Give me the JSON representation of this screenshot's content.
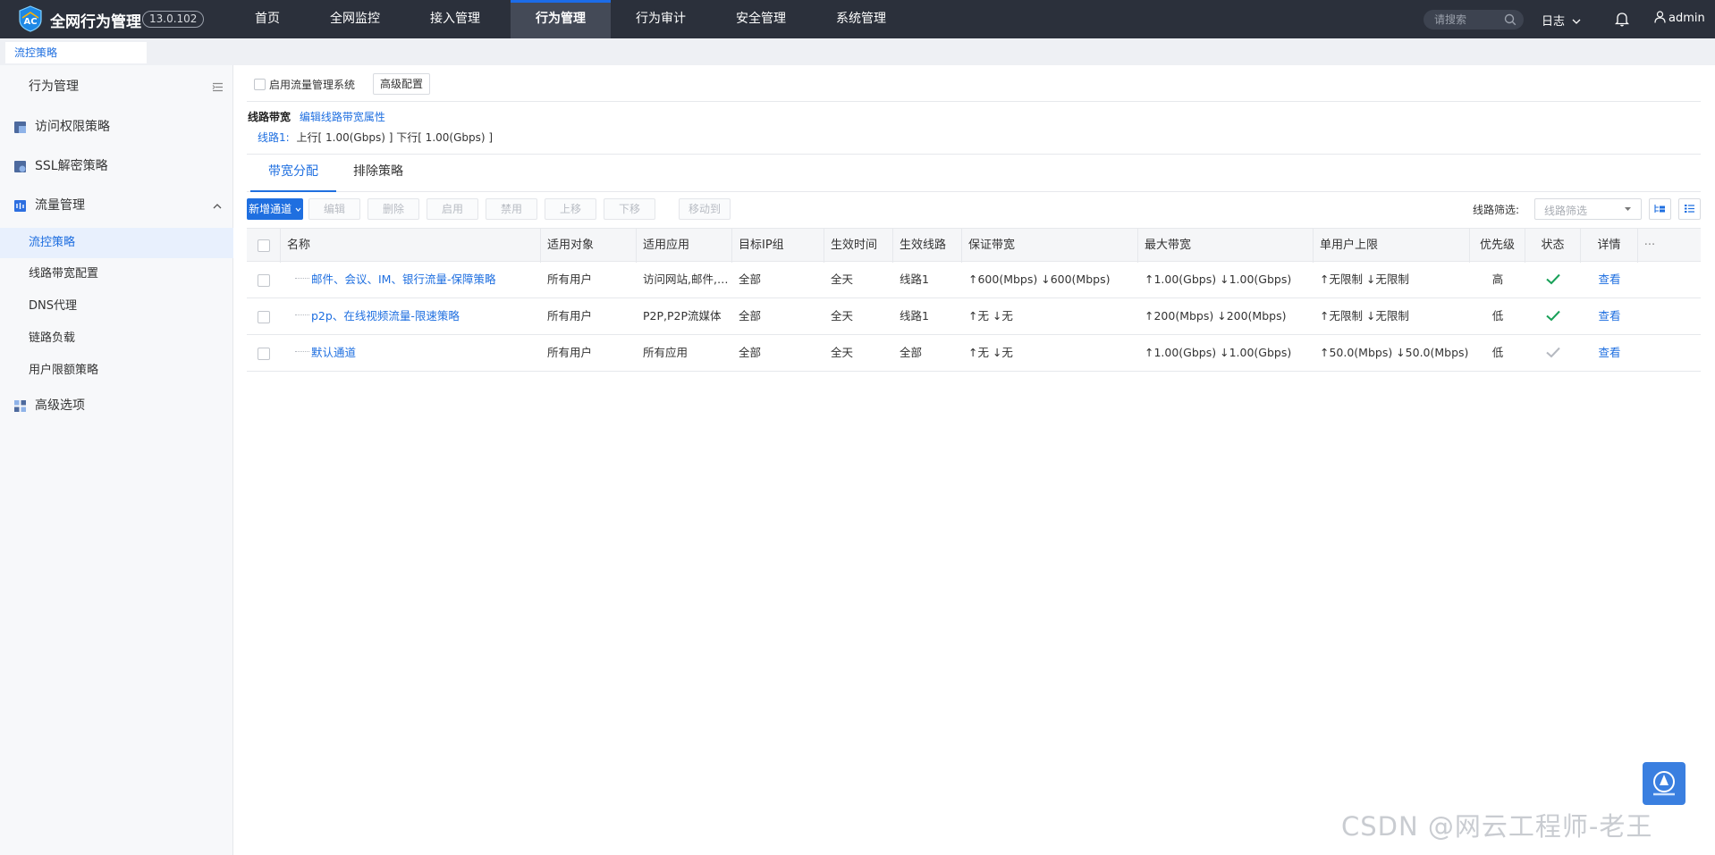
{
  "header": {
    "app_title": "全网行为管理",
    "version": "13.0.102",
    "nav": [
      "首页",
      "全网监控",
      "接入管理",
      "行为管理",
      "行为审计",
      "安全管理",
      "系统管理"
    ],
    "nav_active": "行为管理",
    "search_placeholder": "请搜索",
    "log_label": "日志",
    "user_label": "admin"
  },
  "breadcrumb": {
    "tab_label": "流控策略"
  },
  "sidebar": {
    "title": "行为管理",
    "items": [
      {
        "label": "访问权限策略",
        "icon": "access-policy-icon"
      },
      {
        "label": "SSL解密策略",
        "icon": "ssl-decrypt-icon"
      },
      {
        "label": "流量管理",
        "icon": "traffic-management-icon"
      },
      {
        "label": "高级选项",
        "icon": "advanced-options-icon"
      }
    ],
    "subitems": [
      "流控策略",
      "线路带宽配置",
      "DNS代理",
      "链路负载",
      "用户限额策略"
    ],
    "active_sub": "流控策略"
  },
  "main": {
    "enable_label": "启用流量管理系统",
    "advanced_button": "高级配置",
    "line_bw_title": "线路带宽",
    "edit_line_link": "编辑线路带宽属性",
    "line_name": "线路1:",
    "line_value": "上行[ 1.00(Gbps) ] 下行[ 1.00(Gbps) ]",
    "tabs": [
      "带宽分配",
      "排除策略"
    ],
    "toolbar": {
      "new_channel": "新增通道",
      "edit": "编辑",
      "delete": "删除",
      "enable": "启用",
      "disable": "禁用",
      "move_up": "上移",
      "move_down": "下移",
      "move_to": "移动到",
      "line_filter_label": "线路筛选:",
      "line_filter_placeholder": "线路筛选"
    },
    "table": {
      "headers": [
        "名称",
        "适用对象",
        "适用应用",
        "目标IP组",
        "生效时间",
        "生效线路",
        "保证带宽",
        "最大带宽",
        "单用户上限",
        "优先级",
        "状态",
        "详情",
        "···"
      ],
      "rows": [
        {
          "name": "邮件、会议、IM、银行流量-保障策略",
          "object": "所有用户",
          "app": "访问网站,邮件,微博...",
          "ip": "全部",
          "time": "全天",
          "line": "线路1",
          "guarantee": "↑600(Mbps) ↓600(Mbps)",
          "max": "↑1.00(Gbps) ↓1.00(Gbps)",
          "per_user": "↑无限制 ↓无限制",
          "priority": "高",
          "status": "enabled",
          "detail": "查看"
        },
        {
          "name": "p2p、在线视频流量-限速策略",
          "object": "所有用户",
          "app": "P2P,P2P流媒体",
          "ip": "全部",
          "time": "全天",
          "line": "线路1",
          "guarantee": "↑无 ↓无",
          "max": "↑200(Mbps) ↓200(Mbps)",
          "per_user": "↑无限制 ↓无限制",
          "priority": "低",
          "status": "enabled",
          "detail": "查看"
        },
        {
          "name": "默认通道",
          "object": "所有用户",
          "app": "所有应用",
          "ip": "全部",
          "time": "全天",
          "line": "全部",
          "guarantee": "↑无 ↓无",
          "max": "↑1.00(Gbps) ↓1.00(Gbps)",
          "per_user": "↑50.0(Mbps) ↓50.0(Mbps)",
          "priority": "低",
          "status": "default",
          "detail": "查看"
        }
      ]
    }
  },
  "watermark": "CSDN @网云工程师-老王",
  "colors": {
    "accent": "#1f6fe0",
    "topbar": "#2b303b",
    "ok_green": "#18a058",
    "check_gray": "#b5b9c0"
  }
}
